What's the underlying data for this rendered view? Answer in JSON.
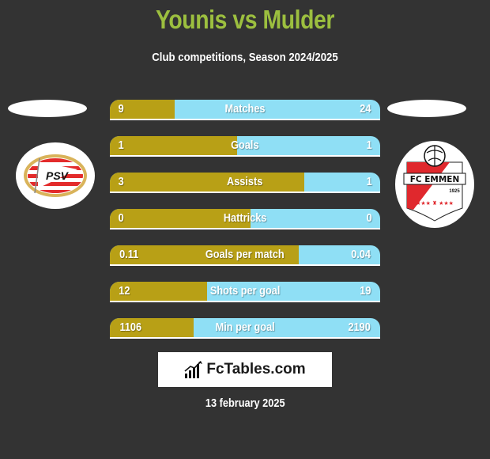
{
  "header": {
    "title": "Younis vs Mulder",
    "subtitle": "Club competitions, Season 2024/2025"
  },
  "players": {
    "left": {
      "club": "PSV",
      "badge_text": "PSV"
    },
    "right": {
      "club": "FC Emmen",
      "badge_text": "FC EMMEN",
      "badge_year": "1925"
    }
  },
  "colors": {
    "title": "#9cbf3f",
    "left_fill": "#b8a016",
    "right_fill": "#8fdff5",
    "background": "#333333"
  },
  "stats": [
    {
      "label": "Matches",
      "left": "9",
      "right": "24",
      "left_share": 0.24
    },
    {
      "label": "Goals",
      "left": "1",
      "right": "1",
      "left_share": 0.47
    },
    {
      "label": "Assists",
      "left": "3",
      "right": "1",
      "left_share": 0.72
    },
    {
      "label": "Hattricks",
      "left": "0",
      "right": "0",
      "left_share": 0.52
    },
    {
      "label": "Goals per match",
      "left": "0.11",
      "right": "0.04",
      "left_share": 0.7
    },
    {
      "label": "Shots per goal",
      "left": "12",
      "right": "19",
      "left_share": 0.36
    },
    {
      "label": "Min per goal",
      "left": "1106",
      "right": "2190",
      "left_share": 0.31
    }
  ],
  "footer": {
    "brand": "FcTables.com",
    "date": "13 february 2025"
  }
}
